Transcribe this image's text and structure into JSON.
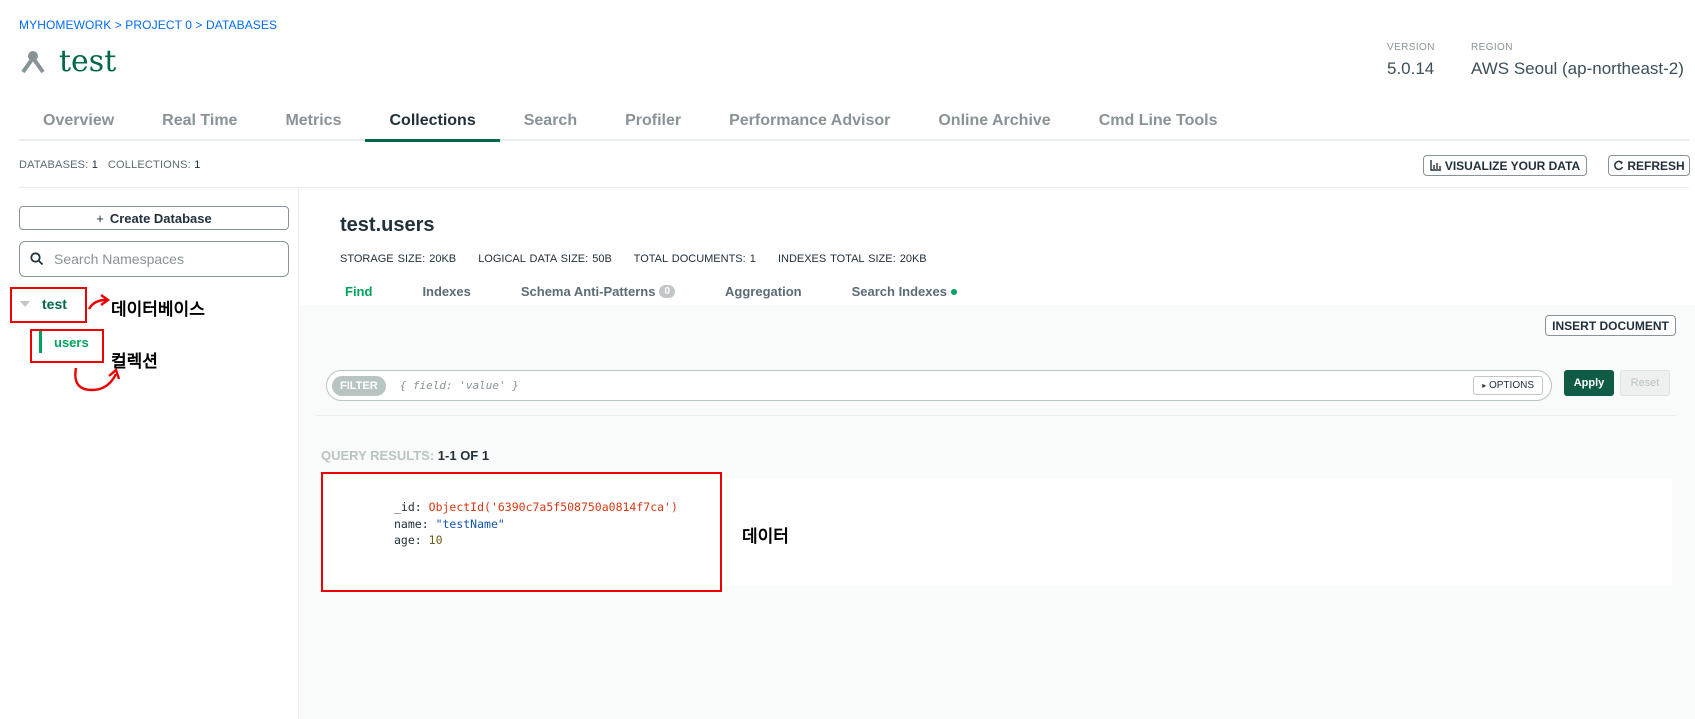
{
  "breadcrumb": "MYHOMEWORK > PROJECT 0 > DATABASES",
  "page_title": "test",
  "version": {
    "label": "VERSION",
    "value": "5.0.14"
  },
  "region": {
    "label": "REGION",
    "value": "AWS Seoul (ap-northeast-2)"
  },
  "tabs": [
    "Overview",
    "Real Time",
    "Metrics",
    "Collections",
    "Search",
    "Profiler",
    "Performance Advisor",
    "Online Archive",
    "Cmd Line Tools"
  ],
  "active_tab": "Collections",
  "stats": {
    "databases_label": "DATABASES:",
    "databases": "1",
    "collections_label": "COLLECTIONS:",
    "collections": "1"
  },
  "visualize_label": "VISUALIZE YOUR DATA",
  "refresh_label": "REFRESH",
  "sidebar": {
    "create_label": "Create Database",
    "search_placeholder": "Search Namespaces",
    "database": "test",
    "collection": "users"
  },
  "annotations": {
    "database": "데이터베이스",
    "collection": "컬렉션",
    "data": "데이터"
  },
  "collection": {
    "title": "test.users",
    "storage": "STORAGE SIZE: 20KB",
    "logical": "LOGICAL DATA SIZE: 50B",
    "total_docs": "TOTAL DOCUMENTS: 1",
    "indexes_total": "INDEXES TOTAL SIZE: 20KB"
  },
  "subtabs": {
    "find": "Find",
    "indexes": "Indexes",
    "schema": "Schema Anti-Patterns",
    "schema_count": "0",
    "aggregation": "Aggregation",
    "search_indexes": "Search Indexes"
  },
  "insert_label": "INSERT DOCUMENT",
  "filter": {
    "tag": "FILTER",
    "placeholder": "{ field: 'value' }",
    "options": "OPTIONS",
    "apply": "Apply",
    "reset": "Reset"
  },
  "query_results": {
    "label": "QUERY RESULTS:",
    "value": "1-1 OF 1"
  },
  "document": {
    "id_key": "_id",
    "id_value": "ObjectId('6390c7a5f508750a0814f7ca')",
    "name_key": "name",
    "name_value": "\"testName\"",
    "age_key": "age",
    "age_value": "10"
  },
  "colors": {
    "brand_green": "#00684a",
    "accent_green": "#00a35c",
    "annotation_red": "#ee0000"
  }
}
